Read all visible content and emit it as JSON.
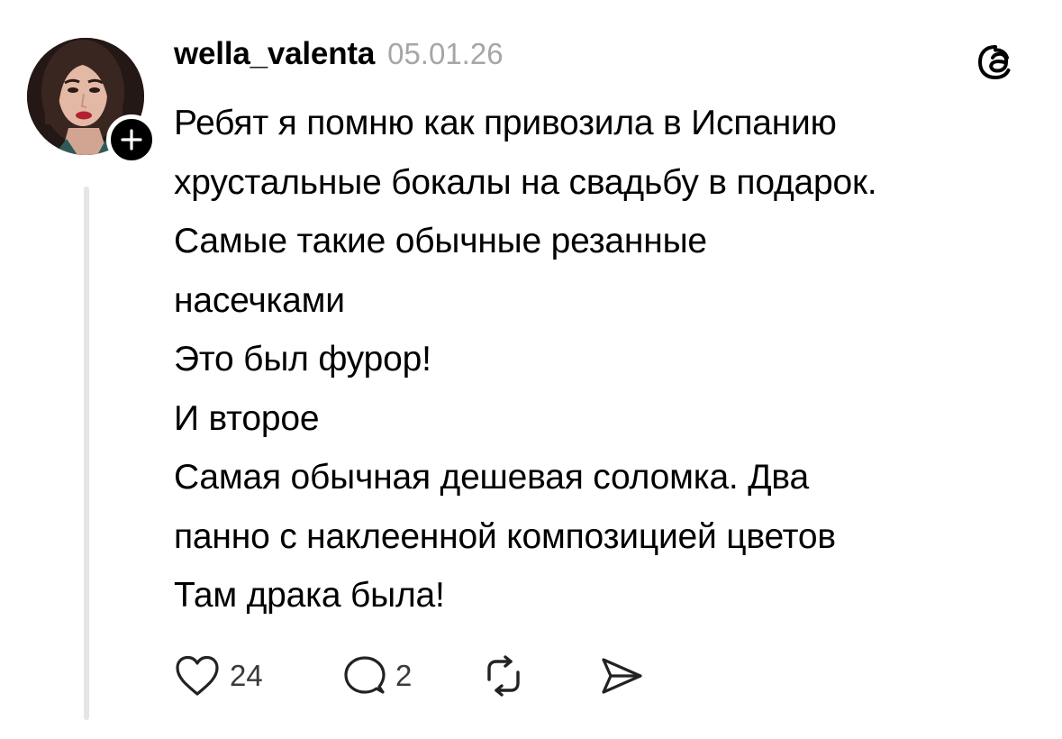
{
  "post": {
    "username": "wella_valenta",
    "date": "05.01.26",
    "follow_icon": "plus-icon",
    "app_logo_icon": "threads-logo-icon",
    "body_lines": [
      "Ребят я помню как привозила в Испанию",
      "хрустальные бокалы на свадьбу в подарок.",
      "Самые такие обычные резанные",
      "насечками",
      "Это был фурор!",
      "И второе",
      "Самая обычная дешевая соломка. Два",
      "панно с наклеенной композицией цветов",
      "Там драка была!"
    ],
    "actions": {
      "like_icon": "heart-icon",
      "like_count": "24",
      "reply_icon": "speech-bubble-icon",
      "reply_count": "2",
      "repost_icon": "repost-icon",
      "share_icon": "send-icon"
    }
  },
  "colors": {
    "text": "#000000",
    "muted": "#a6a6a6",
    "thread_line": "#e5e5e5",
    "follow_badge": "#000000"
  }
}
